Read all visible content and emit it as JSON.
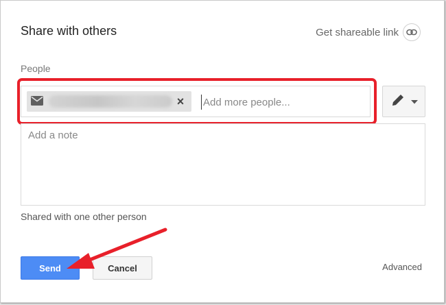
{
  "dialog": {
    "title": "Share with others",
    "shareable_link_label": "Get shareable link"
  },
  "people": {
    "label": "People",
    "chip_icon": "mail-icon",
    "chip_remove_icon": "close-icon",
    "chip_remove_glyph": "×",
    "input_placeholder": "Add more people...",
    "permission_icon": "pencil-icon",
    "permission_dropdown_icon": "caret-down-icon"
  },
  "note": {
    "placeholder": "Add a note"
  },
  "status": {
    "shared_text": "Shared with one other person"
  },
  "actions": {
    "send_label": "Send",
    "cancel_label": "Cancel",
    "advanced_label": "Advanced"
  },
  "colors": {
    "highlight": "#e8202a",
    "send_button": "#4d8cf5",
    "annotation_arrow": "#e8202a"
  }
}
